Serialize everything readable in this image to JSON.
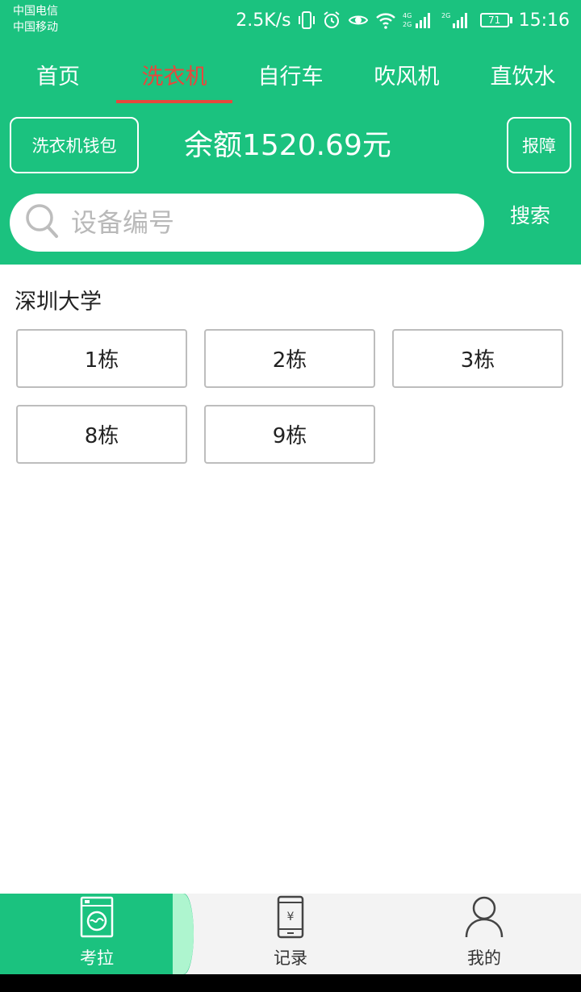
{
  "status_bar": {
    "carrier_1": "中国电信",
    "carrier_2": "中国移动",
    "net_speed": "2.5K/s",
    "battery": "71",
    "time": "15:16",
    "icons": [
      "vibrate-icon",
      "alarm-icon",
      "eye-icon",
      "wifi-icon",
      "signal-4g-icon",
      "signal-2g-icon",
      "battery-icon"
    ]
  },
  "tabs": [
    {
      "label": "首页",
      "active": false
    },
    {
      "label": "洗衣机",
      "active": true
    },
    {
      "label": "自行车",
      "active": false
    },
    {
      "label": "吹风机",
      "active": false
    },
    {
      "label": "直饮水",
      "active": false
    }
  ],
  "header": {
    "wallet_button": "洗衣机钱包",
    "balance": "余额1520.69元",
    "report_button": "报障"
  },
  "search": {
    "placeholder": "设备编号",
    "value": "",
    "button": "搜索"
  },
  "campus": {
    "title": "深圳大学",
    "buildings": [
      "1栋",
      "2栋",
      "3栋",
      "8栋",
      "9栋"
    ]
  },
  "bottom_nav": [
    {
      "label": "考拉",
      "icon": "washing-machine-icon",
      "active": true
    },
    {
      "label": "记录",
      "icon": "phone-yuan-icon",
      "active": false
    },
    {
      "label": "我的",
      "icon": "user-icon",
      "active": false
    }
  ],
  "colors": {
    "primary": "#1bc27f",
    "active_tab": "#e8473c",
    "nav_accent": "#aef5cf"
  }
}
